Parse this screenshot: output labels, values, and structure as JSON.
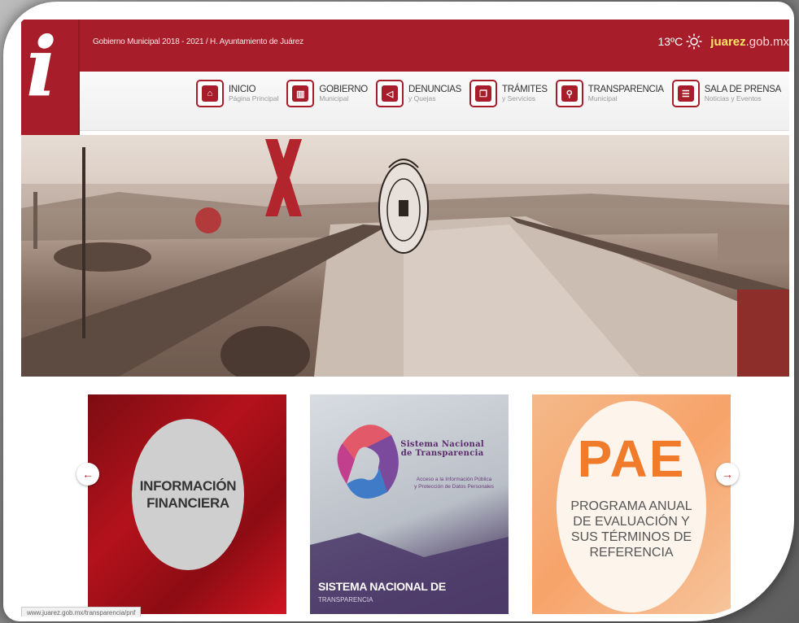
{
  "topbar": {
    "government_text": "Gobierno Municipal 2018 - 2021 / H. Ayuntamiento de Juárez",
    "temperature": "13ºC",
    "brand_name": "juarez",
    "brand_domain": ".gob.mx"
  },
  "logo": {
    "letter": "i"
  },
  "nav": {
    "items": [
      {
        "label": "INICIO",
        "sub": "Página Principal",
        "icon": "home-icon"
      },
      {
        "label": "GOBIERNO",
        "sub": "Municipal",
        "icon": "building-icon"
      },
      {
        "label": "DENUNCIAS",
        "sub": "y Quejas",
        "icon": "megaphone-icon"
      },
      {
        "label": "TRÁMITES",
        "sub": "y Servicios",
        "icon": "document-icon"
      },
      {
        "label": "TRANSPARENCIA",
        "sub": "Municipal",
        "icon": "search-icon"
      },
      {
        "label": "SALA DE PRENSA",
        "sub": "Noticias y Eventos",
        "icon": "newspaper-icon"
      }
    ]
  },
  "carousel": {
    "card1": {
      "line1": "INFORMACIÓN",
      "line2": "FINANCIERA"
    },
    "card2": {
      "title1": "Sistema Nacional",
      "title2": "de Transparencia",
      "sub1": "Acceso a la Información Pública",
      "sub2": "y Protección de Datos Personales",
      "bottom1": "SISTEMA NACIONAL DE",
      "bottom2": "TRANSPARENCIA"
    },
    "card3": {
      "big": "PAE",
      "line1": "PROGRAMA ANUAL",
      "line2": "DE EVALUACIÓN Y",
      "line3": "SUS TÉRMINOS DE",
      "line4": "REFERENCIA"
    },
    "prev_arrow": "←",
    "next_arrow": "→"
  },
  "status_url": "www.juarez.gob.mx/transparencia/pnf"
}
